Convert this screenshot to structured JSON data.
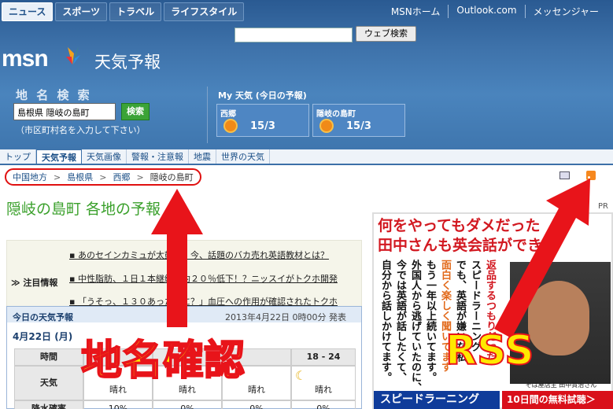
{
  "top_nav": {
    "tabs": [
      {
        "label": "ニュース"
      },
      {
        "label": "スポーツ"
      },
      {
        "label": "トラベル"
      },
      {
        "label": "ライフスタイル"
      }
    ],
    "links": [
      "MSNホーム",
      "Outlook.com",
      "メッセンジャー"
    ]
  },
  "web_search": {
    "button": "ウェブ検索",
    "value": ""
  },
  "logo": {
    "brand": "msn",
    "title": "天気予報"
  },
  "place_search": {
    "label": "地 名 検 索",
    "value": "島根県 隠岐の島町",
    "button": "検索",
    "hint": "（市区町村名を入力して下さい）"
  },
  "my_weather": {
    "title": "My 天気 (今日の予報)",
    "cards": [
      {
        "name": "西郷",
        "temps": "15/3"
      },
      {
        "name": "隠岐の島町",
        "temps": "15/3"
      }
    ]
  },
  "sub_nav": [
    "トップ",
    "天気予報",
    "天気画像",
    "警報・注意報",
    "地震",
    "世界の天気"
  ],
  "breadcrumb": [
    "中国地方",
    "島根県",
    "西郷",
    "隠岐の島町"
  ],
  "page_title": "隠岐の島町 各地の予報",
  "pr_label": "PR",
  "news": {
    "label": "注目情報",
    "items": [
      "あのセインカミュが太鼓判！今、話題のバカ売れ英語教材とは？",
      "中性脂肪、１日１本継続で約２０％低下！？ニッスイがトクホ開発",
      "「うそっ、１３０あったのに？」血圧への作用が確認されたトクホ"
    ]
  },
  "forecast": {
    "title": "今日の天気予報",
    "issued": "2013年4月22日 0時00分 発表",
    "day": "4月22日 (月)",
    "headers": [
      "時間",
      "",
      "",
      "",
      "18 - 24"
    ],
    "weather_row": [
      "天気",
      "晴れ",
      "晴れ",
      "晴れ",
      "晴れ"
    ],
    "rain_row": [
      "降水確率",
      "10%",
      "0%",
      "0%",
      "0%"
    ]
  },
  "ad": {
    "headline1": "何をやってもダメだった",
    "headline2": "田中さんも英会話ができた",
    "columns": [
      "自分から話しかけてます。",
      "今では英語が話したくて、",
      "外国人から逃げていたのに、",
      "もう一年以上続いてます。",
      "面白く楽しく聞いてます",
      "でも、英語が嫌いな私",
      "スピードラーニング",
      "返品するつもりだった"
    ],
    "caption": "そば屋店主 田中賢治さん",
    "bar_left": "スピードラーニング",
    "bar_right": "10日間の無料試聴＞"
  },
  "annotations": {
    "place_confirm": "地名確認",
    "rss": "RSS"
  },
  "colors": {
    "annotation_red": "#e8141a",
    "annotation_yellow": "#ffe800",
    "title_green": "#3aa02b",
    "header_blue": "#3e72aa"
  }
}
